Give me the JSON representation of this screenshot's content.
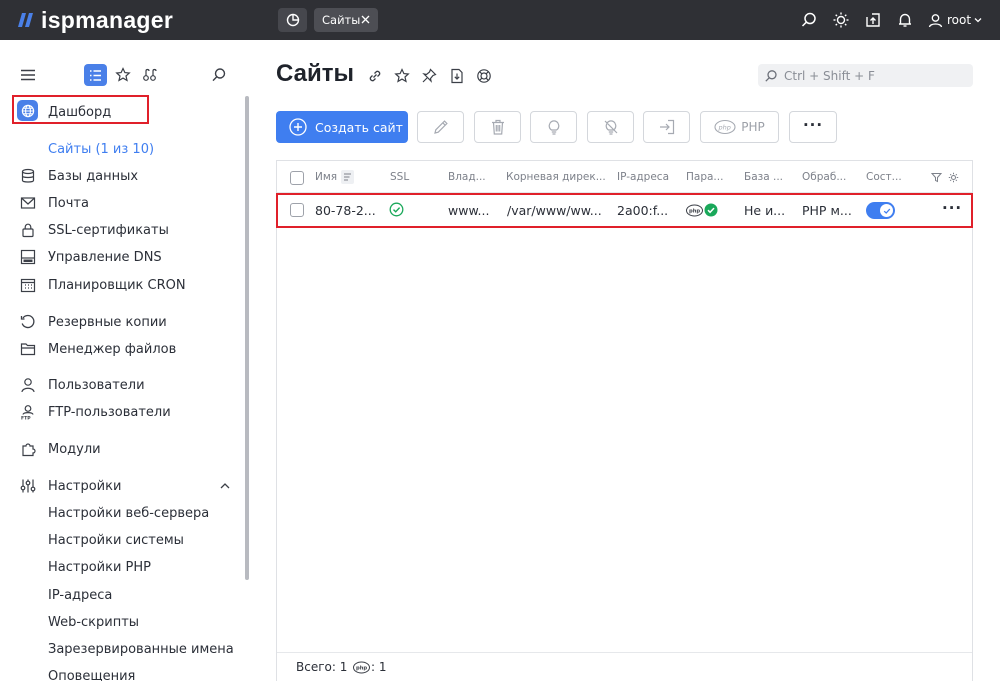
{
  "app": {
    "logo_text": "ispmanager"
  },
  "topbar": {
    "tab_label": "Сайты",
    "user_label": "root",
    "icons": [
      "dashboard-icon",
      "search-icon",
      "theme-icon",
      "upload-icon",
      "bell-icon",
      "user-icon"
    ]
  },
  "sidebar": {
    "items": [
      {
        "label": "Дашборд",
        "icon": "dashboard-icon"
      },
      {
        "label": "Сайты (1 из 10)",
        "icon": "globe-icon",
        "active": true
      },
      {
        "label": "Базы данных",
        "icon": "database-icon"
      },
      {
        "label": "Почта",
        "icon": "mail-icon"
      },
      {
        "label": "SSL-сертификаты",
        "icon": "certificate-icon"
      },
      {
        "label": "Управление DNS",
        "icon": "dns-icon"
      },
      {
        "label": "Планировщик CRON",
        "icon": "calendar-icon"
      },
      {
        "label": "Резервные копии",
        "icon": "backup-icon"
      },
      {
        "label": "Менеджер файлов",
        "icon": "folder-icon"
      },
      {
        "label": "Пользователи",
        "icon": "user-icon"
      },
      {
        "label": "FTP-пользователи",
        "icon": "ftp-icon"
      },
      {
        "label": "Модули",
        "icon": "modules-icon"
      },
      {
        "label": "Настройки",
        "icon": "settings-icon"
      }
    ],
    "settings_subitems": [
      "Настройки веб-сервера",
      "Настройки системы",
      "Настройки PHP",
      "IP-адреса",
      "Web-скрипты",
      "Зарезервированные имена",
      "Оповещения"
    ]
  },
  "main": {
    "title": "Сайты",
    "search_placeholder": "Ctrl + Shift + F",
    "create_button": "Создать сайт",
    "php_button": "PHP",
    "more_button": "···"
  },
  "table": {
    "columns": [
      "Имя",
      "SSL",
      "Влад...",
      "Корневая дирек...",
      "IP-адреса",
      "Пара...",
      "База ...",
      "Обраб...",
      "Сост..."
    ],
    "rows": [
      {
        "name": "80-78-2...",
        "owner": "www...",
        "root_dir": "/var/www/ww...",
        "ip": "2a00:f...",
        "database": "Не и...",
        "handler": "PHP м...",
        "state_on": true,
        "more": "···"
      }
    ]
  },
  "footer": {
    "total": "Всего: 1",
    "php_count": ": 1"
  },
  "colors": {
    "accent": "#3f7ef0",
    "topbar": "#2f3035",
    "highlight": "#e0202a",
    "success": "#1aa85a"
  }
}
